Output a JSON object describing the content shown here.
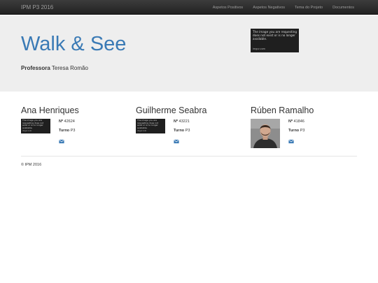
{
  "navbar": {
    "brand": "IPM P3 2016",
    "links": [
      "Aspetos Positivos",
      "Aspetos Negativos",
      "Tema do Projeto",
      "Documentos"
    ]
  },
  "jumbotron": {
    "title": "Walk & See",
    "professor_label": "Professora",
    "professor_name": "Teresa Romão",
    "banner_image": {
      "message": "The image you are requesting does not exist or is no longer available.",
      "source": "imgur.com"
    }
  },
  "members": [
    {
      "name": "Ana Henriques",
      "number_label": "Nº",
      "number": "42624",
      "turno_label": "Turno",
      "turno": "P3",
      "photo_message": "The image you are requesting does not exist or is no longer available.",
      "photo_source": "imgur.com"
    },
    {
      "name": "Guilherme Seabra",
      "number_label": "Nº",
      "number": "43221",
      "turno_label": "Turno",
      "turno": "P3",
      "photo_message": "The image you are requesting does not exist or is no longer available.",
      "photo_source": "imgur.com"
    },
    {
      "name": "Rúben Ramalho",
      "number_label": "Nº",
      "number": "41846",
      "turno_label": "Turno",
      "turno": "P3"
    }
  ],
  "icons": {
    "mail": "envelope-icon"
  },
  "colors": {
    "accent": "#3a7ab5",
    "navbar": "#222222",
    "jumbotron": "#eeeeee"
  },
  "footer": {
    "text": "© IPM 2016"
  }
}
